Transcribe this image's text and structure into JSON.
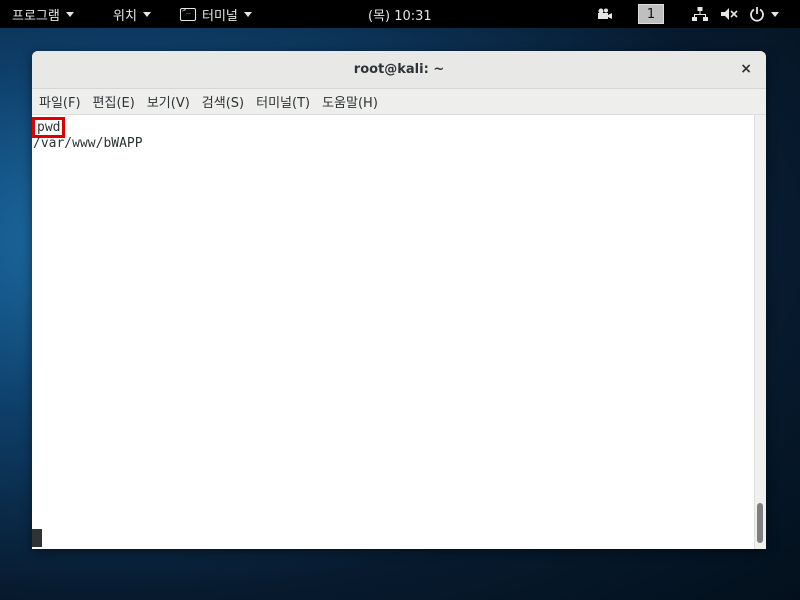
{
  "topbar": {
    "programs": "프로그램",
    "places": "위치",
    "terminal_app": "터미널",
    "clock": "(목) 10:31",
    "workspace": "1"
  },
  "window": {
    "title": "root@kali: ~",
    "close": "×"
  },
  "menubar": {
    "items": [
      "파일(F)",
      "편집(E)",
      "보기(V)",
      "검색(S)",
      "터미널(T)",
      "도움말(H)"
    ]
  },
  "terminal": {
    "lines": [
      "pwd",
      "/var/www/bWAPP"
    ]
  }
}
